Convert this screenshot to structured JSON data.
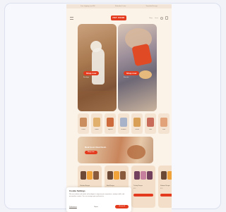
{
  "topbar": [
    "Free shipping over $50",
    "Subscribe & save",
    "Download the app"
  ],
  "header": {
    "logo_text": "PET FOOD",
    "nav_links": [
      "Shop",
      "Learn"
    ]
  },
  "hero": [
    {
      "cta": "Shop now",
      "caption": "For dogs"
    },
    {
      "cta": "Shop now",
      "caption": "For cats"
    }
  ],
  "categories": [
    {
      "label": "Treats",
      "color": "#c98d5e"
    },
    {
      "label": "Kibble",
      "color": "#e2b06d"
    },
    {
      "label": "Toppers",
      "color": "#ce6b3c"
    },
    {
      "label": "Bundles",
      "color": "#a8b3c9"
    },
    {
      "label": "Chews",
      "color": "#d9a055"
    },
    {
      "label": "Gifts",
      "color": "#c96b59"
    },
    {
      "label": "Sale",
      "color": "#e2a27a"
    }
  ],
  "banner": {
    "headline": "Real food. Real fresh.",
    "cta": "Shop now"
  },
  "products": [
    {
      "name": "Chicken Recipe",
      "price": "$24",
      "colors": [
        "#6c4a35",
        "#f0a33b",
        "#8a5a3c"
      ]
    },
    {
      "name": "Beef Recipe",
      "price": "$26",
      "colors": [
        "#6c4a35",
        "#f0a33b",
        "#8a5a3c"
      ]
    },
    {
      "name": "Turkey Recipe",
      "price": "$24",
      "colors": [
        "#73405e",
        "#c77f9e",
        "#73405e"
      ]
    },
    {
      "name": "Salmon Recipe",
      "price": "$28",
      "colors": [
        "#6c4a35",
        "#f0a33b",
        "#8a5a3c"
      ]
    }
  ],
  "cookie": {
    "title": "Cookie Settings",
    "text": "We use cookies and similar technologies to improve your experience, analyze traffic and personalize content. You can manage your preferences.",
    "settings_label": "Preferences",
    "reject_label": "Reject",
    "accept_label": "Accept all"
  },
  "colors": {
    "brand": "#e43a1e",
    "background": "#fbf2e8"
  }
}
